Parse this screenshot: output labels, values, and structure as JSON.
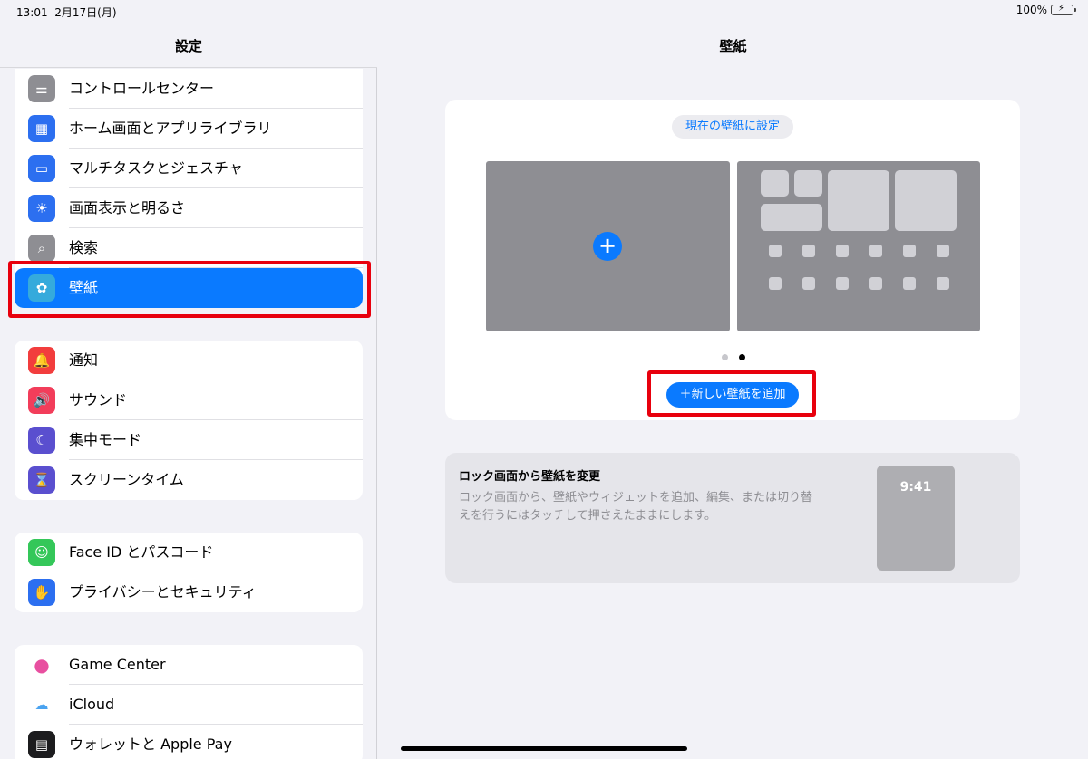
{
  "status": {
    "time": "13:01",
    "date": "2月17日(月)",
    "battery": "100%"
  },
  "sidebar": {
    "title": "設定",
    "group1": [
      {
        "label": "コントロールセンター",
        "icon": "toggles-icon",
        "color": "#8e8e93"
      },
      {
        "label": "ホーム画面とアプリライブラリ",
        "icon": "home-screen-icon",
        "color": "#2c6ff0"
      },
      {
        "label": "マルチタスクとジェスチャ",
        "icon": "multitask-icon",
        "color": "#2c6ff0"
      },
      {
        "label": "画面表示と明るさ",
        "icon": "brightness-icon",
        "color": "#2c6ff0"
      },
      {
        "label": "検索",
        "icon": "search-icon",
        "color": "#8e8e93"
      },
      {
        "label": "壁紙",
        "icon": "flower-icon",
        "color": "#35aadc",
        "selected": true
      }
    ],
    "group2": [
      {
        "label": "通知",
        "icon": "bell-icon",
        "color": "#f23d3d"
      },
      {
        "label": "サウンド",
        "icon": "speaker-icon",
        "color": "#f23d5a"
      },
      {
        "label": "集中モード",
        "icon": "moon-icon",
        "color": "#5a4fcf"
      },
      {
        "label": "スクリーンタイム",
        "icon": "hourglass-icon",
        "color": "#5a4fcf"
      }
    ],
    "group3": [
      {
        "label": "Face ID とパスコード",
        "icon": "face-id-icon",
        "color": "#34c759"
      },
      {
        "label": "プライバシーとセキュリティ",
        "icon": "hand-icon",
        "color": "#2c6ff0"
      }
    ],
    "group4": [
      {
        "label": "Game Center",
        "icon": "game-center-icon",
        "color": "#ffffff"
      },
      {
        "label": "iCloud",
        "icon": "cloud-icon",
        "color": "#ffffff"
      },
      {
        "label": "ウォレットと Apple Pay",
        "icon": "wallet-icon",
        "color": "#1c1c1e"
      }
    ]
  },
  "main": {
    "title": "壁紙",
    "set_current": "現在の壁紙に設定",
    "add_new": "＋新しい壁紙を追加",
    "info_title": "ロック画面から壁紙を変更",
    "info_desc": "ロック画面から、壁紙やウィジェットを追加、編集、または切り替えを行うにはタッチして押さえたままにします。",
    "preview_time": "9:41"
  },
  "colors": {
    "accent": "#0a7aff",
    "highlight": "#e8000d"
  }
}
